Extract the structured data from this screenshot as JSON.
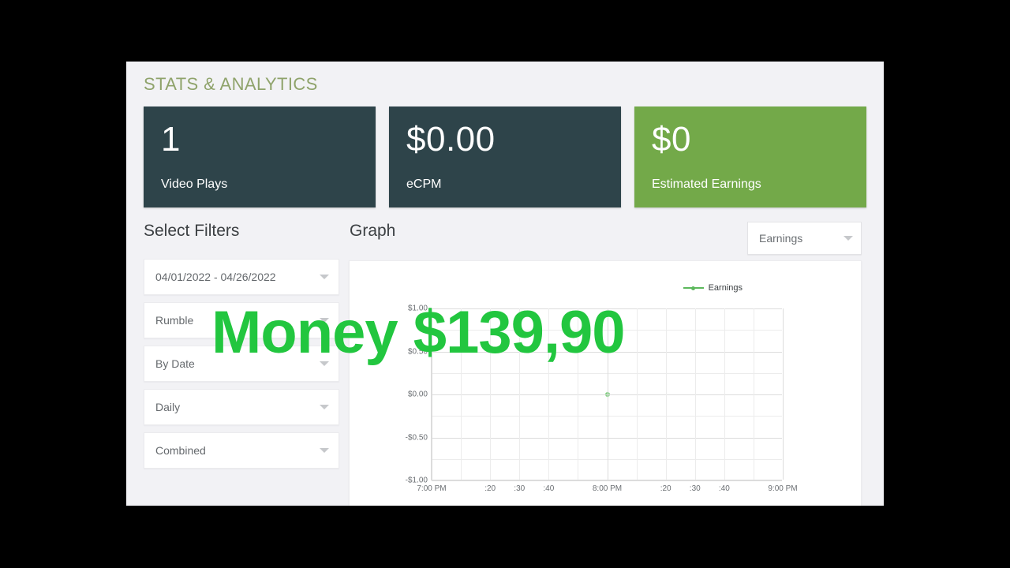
{
  "section": {
    "title": "STATS & ANALYTICS",
    "title_color": "#8fa36b"
  },
  "cards": [
    {
      "value": "1",
      "label": "Video Plays",
      "style": "dark",
      "color": "#2e444a"
    },
    {
      "value": "$0.00",
      "label": "eCPM",
      "style": "dark",
      "color": "#2e444a"
    },
    {
      "value": "$0",
      "label": "Estimated Earnings",
      "style": "green",
      "color": "#73a949"
    }
  ],
  "filters": {
    "heading": "Select Filters",
    "fields": [
      {
        "name": "date-range",
        "value": "04/01/2022 - 04/26/2022"
      },
      {
        "name": "platform",
        "value": "Rumble"
      },
      {
        "name": "group-by",
        "value": "By Date"
      },
      {
        "name": "interval",
        "value": "Daily"
      },
      {
        "name": "source",
        "value": "Combined"
      }
    ]
  },
  "graph": {
    "heading": "Graph",
    "metric_select": {
      "value": "Earnings"
    }
  },
  "overlay": {
    "text": "Money $139,90",
    "color": "#22c63f"
  },
  "chart_data": {
    "type": "line",
    "title": "",
    "xlabel": "",
    "ylabel": "",
    "legend": [
      "Earnings"
    ],
    "legend_position": "top-right",
    "grid": true,
    "line_color": "#5cb85c",
    "zero_line_color": "#555a5e",
    "ylim": [
      -1.0,
      1.0
    ],
    "yticks": [
      1.0,
      0.5,
      0.0,
      -0.5,
      -1.0
    ],
    "ytick_labels": [
      "$1.00",
      "$0.50",
      "$0.00",
      "-$0.50",
      "-$1.00"
    ],
    "xticks": [
      "7:00 PM",
      ":10",
      ":20",
      ":30",
      ":40",
      ":50",
      "8:00 PM",
      ":10",
      ":20",
      ":30",
      ":40",
      ":50",
      "9:00 PM"
    ],
    "xtick_labels_shown": [
      "7:00 PM",
      ":20",
      ":30",
      ":40",
      "8:00 PM",
      ":20",
      ":30",
      ":40",
      "9:00 PM"
    ],
    "series": [
      {
        "name": "Earnings",
        "x": [
          "7:00 PM",
          "8:00 PM",
          "9:00 PM"
        ],
        "values": [
          0.0,
          0.0,
          0.0
        ],
        "markers": [
          {
            "x": "8:00 PM",
            "y": 0.0
          }
        ]
      }
    ]
  }
}
